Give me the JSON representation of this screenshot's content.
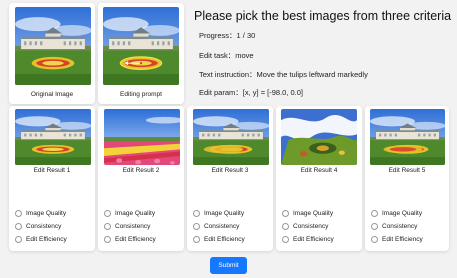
{
  "header": {
    "title": "Please pick the best images from three criteria",
    "progress_label": "Progress：",
    "progress_value": "1 / 30",
    "task_label": "Edit task：",
    "task_value": "move",
    "instruction_label": "Text instruction：",
    "instruction_value": "Move the tulips leftward markedly",
    "param_label": "Edit param：",
    "param_value": "[x, y] = [-98.0, 0.0]"
  },
  "top_images": [
    {
      "caption": "Original Image"
    },
    {
      "caption": "Editing prompt"
    }
  ],
  "results": [
    {
      "caption": "Edit Result 1"
    },
    {
      "caption": "Edit Result 2"
    },
    {
      "caption": "Edit Result 3"
    },
    {
      "caption": "Edit Result 4"
    },
    {
      "caption": "Edit Result 5"
    }
  ],
  "criteria": [
    "Image Quality",
    "Consistency",
    "Edit Efficiency"
  ],
  "submit_label": "Submit",
  "colors": {
    "accent": "#1677ff",
    "background": "#f2f2f2"
  }
}
